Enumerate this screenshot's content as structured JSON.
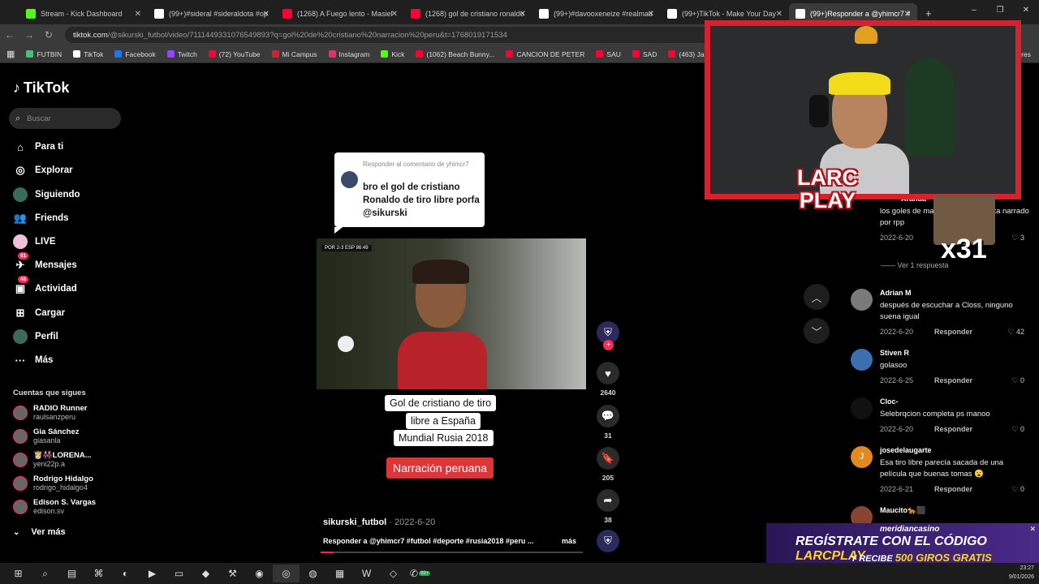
{
  "browser": {
    "tabs": [
      {
        "label": "Stream - Kick Dashboard",
        "icon_color": "#53fc18",
        "active": false
      },
      {
        "label": "(99+)#sideral #sideraldota #op",
        "icon_color": "#ffffff",
        "active": false
      },
      {
        "label": "(1268) A Fuego lento - Masiel",
        "icon_color": "#ff0033",
        "active": false
      },
      {
        "label": "(1268) gol de cristiano ronaldo",
        "icon_color": "#ff0033",
        "active": false
      },
      {
        "label": "(99+)#davooxeneize #realmad",
        "icon_color": "#ffffff",
        "active": false
      },
      {
        "label": "(99+)TikTok - Make Your Day",
        "icon_color": "#ffffff",
        "active": false
      },
      {
        "label": "(99+)Responder a @yhimcr7 #",
        "icon_color": "#ffffff",
        "active": true
      }
    ],
    "new_tab": "+",
    "url_host": "tiktok.com",
    "url_path": "/@sikurski_futbol/video/7111449331076549893?q=gol%20de%20cristiano%20narracion%20peru&t=1768019171534",
    "bookmarks": [
      {
        "label": "FUTBIN",
        "color": "#49c07a"
      },
      {
        "label": "TikTok",
        "color": "#ffffff"
      },
      {
        "label": "Facebook",
        "color": "#1877f2"
      },
      {
        "label": "Twitch",
        "color": "#9146ff"
      },
      {
        "label": "(72) YouTube",
        "color": "#ff0033"
      },
      {
        "label": "Mi Campus",
        "color": "#cc2233"
      },
      {
        "label": "Instagram",
        "color": "#e1306c"
      },
      {
        "label": "Kick",
        "color": "#53fc18"
      },
      {
        "label": "(1062) Beach Bunny...",
        "color": "#ff0033"
      },
      {
        "label": "CANCION DE PETER",
        "color": "#ff0033"
      },
      {
        "label": "SAU",
        "color": "#ff0033"
      },
      {
        "label": "SAD",
        "color": "#ff0033"
      },
      {
        "label": "(463) James Arthur -...",
        "color": "#ff0033"
      }
    ],
    "bookmarks_overflow": "ores"
  },
  "tiktok": {
    "logo": "TikTok",
    "search_placeholder": "Buscar",
    "nav": [
      {
        "label": "Para ti",
        "icon": "home-icon",
        "glyph": "⌂"
      },
      {
        "label": "Explorar",
        "icon": "compass-icon",
        "glyph": "◎"
      },
      {
        "label": "Siguiendo",
        "icon": "following-avatar-icon",
        "glyph": "●"
      },
      {
        "label": "Friends",
        "icon": "friends-icon",
        "glyph": "👥"
      },
      {
        "label": "LIVE",
        "icon": "live-avatar-icon",
        "glyph": "●"
      },
      {
        "label": "Mensajes",
        "icon": "messages-icon",
        "glyph": "✈",
        "badge": "81"
      },
      {
        "label": "Actividad",
        "icon": "activity-icon",
        "glyph": "▣",
        "badge": "48"
      },
      {
        "label": "Cargar",
        "icon": "upload-icon",
        "glyph": "⊞"
      },
      {
        "label": "Perfil",
        "icon": "profile-avatar-icon",
        "glyph": "▬"
      },
      {
        "label": "Más",
        "icon": "more-icon",
        "glyph": "···"
      }
    ],
    "following_title": "Cuentas que sigues",
    "following": [
      {
        "name": "RADIO Runner",
        "handle": "raulsanzperu"
      },
      {
        "name": "Gia Sánchez",
        "handle": "giasanla"
      },
      {
        "name": "👸🏻👭LORENA...",
        "handle": "yeni22p.a"
      },
      {
        "name": "Rodrigo Hidalgo",
        "handle": "rodrigo_hidalgo4"
      },
      {
        "name": "Edison S. Vargas",
        "handle": "edison.sv"
      }
    ],
    "see_more": "Ver más"
  },
  "video": {
    "reply_label": "Responder al comentario de yhimcr7",
    "reply_text": "bro el gol de cristiano Ronaldo de tiro libre porfa @sikurski",
    "scoreboard": "POR 2-3 ESP 86:49",
    "captions": [
      "Gol de cristiano de tiro",
      "libre a España",
      "Mundial Rusia 2018"
    ],
    "caption_red": "Narración peruana",
    "author": "sikurski_futbol",
    "date": "2022-6-20",
    "description": "Responder a @yhimcr7 #futbol #deporte #rusia2018 #peru ...",
    "more": "más",
    "progress": 0.05,
    "actions": {
      "likes": "2640",
      "comments": "31",
      "saves": "205",
      "shares": "38"
    }
  },
  "comments": [
    {
      "user": "Aranda",
      "text": "los goles de manchester city ... elta narrado por rpp",
      "date": "2022-6-20",
      "likes": "3",
      "avatar_color": "#665544"
    },
    {
      "view_replies": "Ver 1 respuesta"
    },
    {
      "user": "Adrian M",
      "text": "después de escuchar a Closs, ninguno suena igual",
      "date": "2022-6-20",
      "reply": "Responder",
      "likes": "42",
      "avatar_color": "#7a7a7a"
    },
    {
      "user": "Stiven R",
      "text": "golasoo",
      "date": "2022-6-25",
      "reply": "Responder",
      "likes": "0",
      "avatar_color": "#3b6fb0"
    },
    {
      "user": "Cloc-",
      "text": "Selebrqcion completa ps manoo",
      "date": "2022-6-20",
      "reply": "Responder",
      "likes": "0",
      "avatar_color": "#111111"
    },
    {
      "user": "josedelaugarte",
      "text": "Esa tiro libre parecía sacada de una película que buenas tomas 😮",
      "date": "2022-6-21",
      "reply": "Responder",
      "likes": "0",
      "avatar_color": "#e08a20",
      "initial": "J"
    },
    {
      "user": "Maucito🐆⬛",
      "text": "...",
      "avatar_color": "#884433"
    }
  ],
  "overlay": {
    "brand_line1": "LARC",
    "brand_line2": "PLAY",
    "counter": "x31"
  },
  "ad": {
    "brand": "meridiancasino",
    "line1": "REGÍSTRATE CON EL CÓDIGO",
    "code": "LARCPLAY",
    "line2_prefix": "Y RECIBE",
    "line2_bold": "500 GIROS GRATIS"
  },
  "taskbar": {
    "time": "23:27",
    "date": "9/01/2026",
    "apps_badge": "99+"
  }
}
